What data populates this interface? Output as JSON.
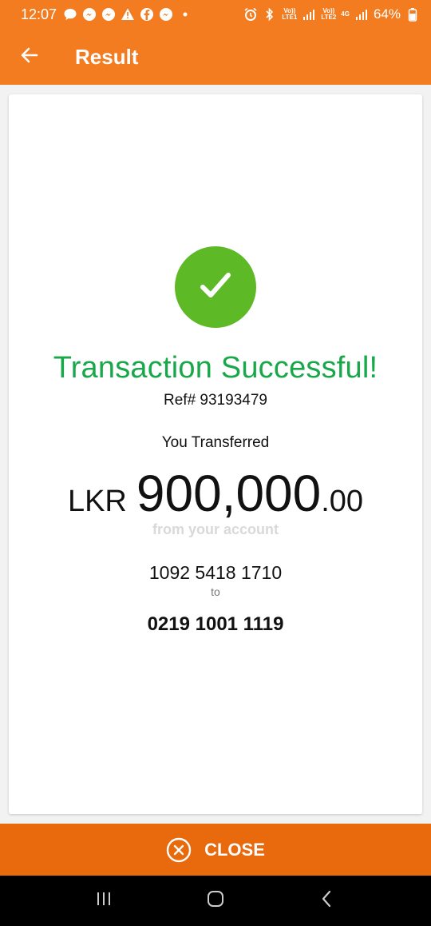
{
  "status_bar": {
    "time": "12:07",
    "battery": "64%",
    "lte1_top": "Vo))",
    "lte1_bottom": "LTE1",
    "lte2_top": "Vo))",
    "lte2_bottom": "LTE2",
    "network": "4G",
    "icons": [
      "chat-icon",
      "messenger-icon",
      "messenger-icon",
      "warning-icon",
      "facebook-icon",
      "messenger-icon",
      "dot-icon",
      "alarm-icon",
      "bluetooth-icon",
      "signal-icon",
      "signal-icon",
      "battery-icon"
    ]
  },
  "header": {
    "title": "Result",
    "back_icon": "arrow-left-icon"
  },
  "result": {
    "status_icon": "check-icon",
    "title": "Transaction Successful!",
    "ref": "Ref# 93193479",
    "transferred_label": "You Transferred",
    "currency": "LKR",
    "amount_main": "900,000",
    "amount_cents": ".00",
    "from_label": "from your account",
    "from_account": "1092 5418 1710",
    "to_label": "to",
    "to_account": "0219 1001 1119"
  },
  "footer": {
    "close_label": "CLOSE",
    "close_icon": "close-circle-icon"
  },
  "colors": {
    "brand_orange": "#f47c20",
    "close_orange": "#e96a0c",
    "success_green": "#5db926",
    "title_green": "#18a84a"
  }
}
